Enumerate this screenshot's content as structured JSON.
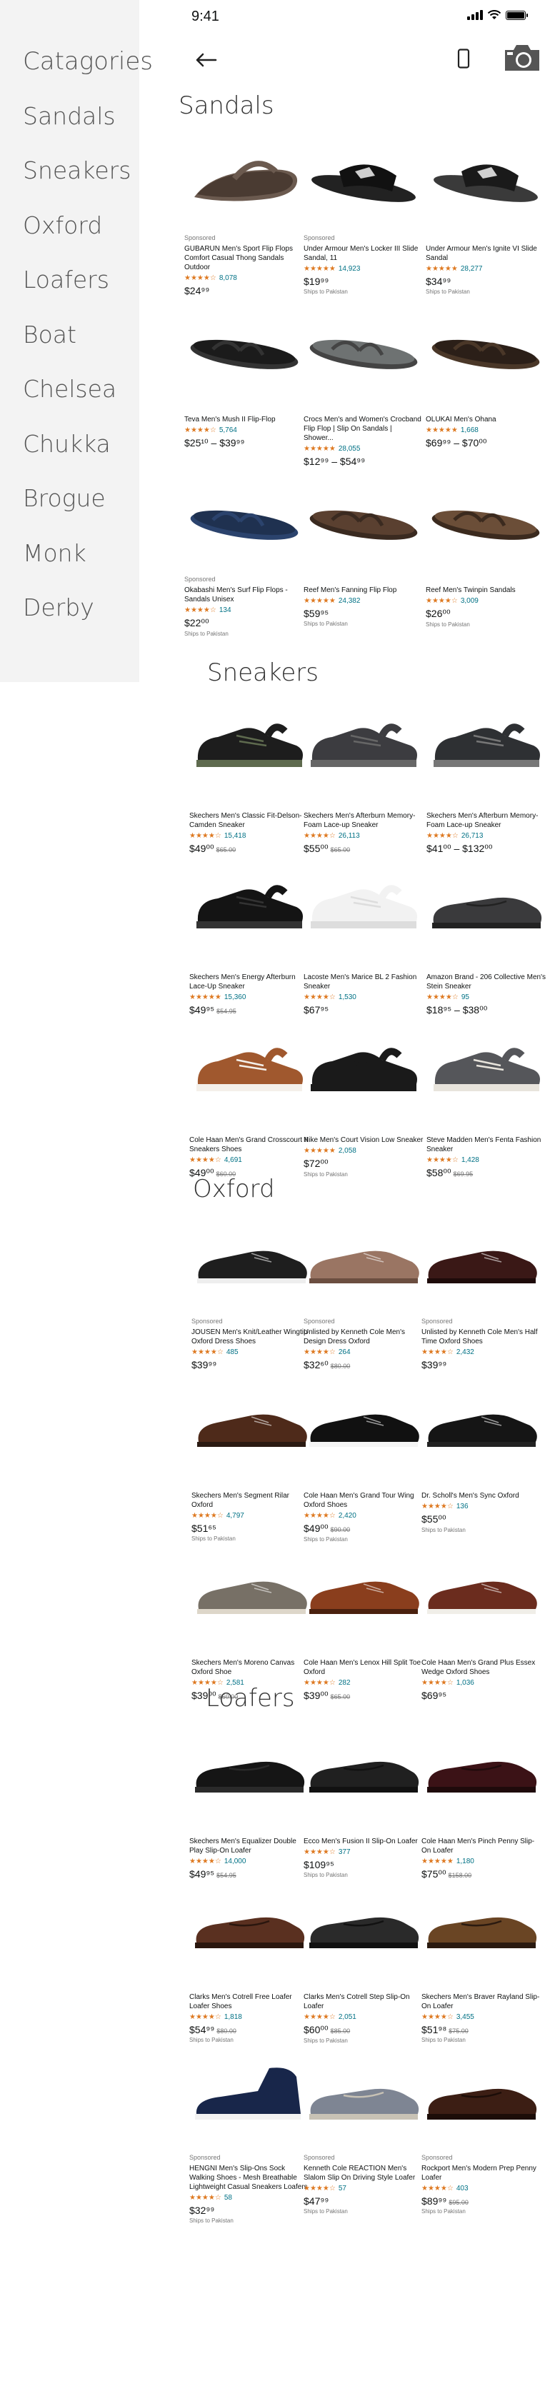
{
  "status": {
    "time": "9:41"
  },
  "sidebar": {
    "items": [
      {
        "label": "Catagories"
      },
      {
        "label": "Sandals"
      },
      {
        "label": "Sneakers"
      },
      {
        "label": "Oxford"
      },
      {
        "label": "Loafers"
      },
      {
        "label": "Boat"
      },
      {
        "label": "Chelsea"
      },
      {
        "label": "Chukka"
      },
      {
        "label": "Brogue"
      },
      {
        "label": "Monk"
      },
      {
        "label": "Derby"
      }
    ]
  },
  "sections": [
    {
      "title": "Sandals",
      "products": [
        {
          "sponsored": "Sponsored",
          "title": "GUBARUN Men's Sport Flip Flops Comfort Casual Thong Sandals Outdoor",
          "stars": "★★★★☆",
          "count": "8,078",
          "price": "$24⁹⁹",
          "strike": "",
          "ships": "",
          "shoe": "sandal-brown"
        },
        {
          "sponsored": "Sponsored",
          "title": "Under Armour Men's Locker III Slide Sandal, 11",
          "stars": "★★★★★",
          "count": "14,923",
          "price": "$19⁹⁹",
          "strike": "",
          "ships": "Ships to Pakistan",
          "shoe": "slide-black"
        },
        {
          "sponsored": "",
          "title": "Under Armour Men's Ignite VI Slide Sandal",
          "stars": "★★★★★",
          "count": "28,277",
          "price": "$34⁹⁹",
          "strike": "",
          "ships": "Ships to Pakistan",
          "shoe": "slide-black2"
        },
        {
          "sponsored": "",
          "title": "Teva Men's Mush II Flip-Flop",
          "stars": "★★★★☆",
          "count": "5,764",
          "price": "$25¹⁰ – $39⁹⁹",
          "strike": "",
          "ships": "",
          "shoe": "flip-black"
        },
        {
          "sponsored": "",
          "title": "Crocs Men's and Women's Crocband Flip Flop | Slip On Sandals | Shower...",
          "stars": "★★★★★",
          "count": "28,055",
          "price": "$12⁹⁹ – $54⁹⁹",
          "strike": "",
          "ships": "",
          "shoe": "flip-gray"
        },
        {
          "sponsored": "",
          "title": "OLUKAI Men's Ohana",
          "stars": "★★★★★",
          "count": "1,668",
          "price": "$69⁹⁹ – $70⁰⁰",
          "strike": "",
          "ships": "",
          "shoe": "flip-darkbrown"
        },
        {
          "sponsored": "Sponsored",
          "title": "Okabashi Men's Surf Flip Flops - Sandals Unisex",
          "stars": "★★★★☆",
          "count": "134",
          "price": "$22⁰⁰",
          "strike": "",
          "ships": "Ships to Pakistan",
          "shoe": "flip-navy"
        },
        {
          "sponsored": "",
          "title": "Reef Men's Fanning Flip Flop",
          "stars": "★★★★★",
          "count": "24,382",
          "price": "$59⁹⁵",
          "strike": "",
          "ships": "Ships to Pakistan",
          "shoe": "flip-brown"
        },
        {
          "sponsored": "",
          "title": "Reef Men's Twinpin Sandals",
          "stars": "★★★★☆",
          "count": "3,009",
          "price": "$26⁰⁰",
          "strike": "",
          "ships": "Ships to Pakistan",
          "shoe": "flip-brown2"
        }
      ]
    },
    {
      "title": "Sneakers",
      "products": [
        {
          "sponsored": "",
          "title": "Skechers Men's Classic Fit-Delson-Camden Sneaker",
          "stars": "★★★★☆",
          "count": "15,418",
          "price": "$49⁰⁰",
          "strike": "$65.00",
          "ships": "",
          "shoe": "sneaker-black-olive"
        },
        {
          "sponsored": "",
          "title": "Skechers Men's Afterburn Memory-Foam Lace-up Sneaker",
          "stars": "★★★★☆",
          "count": "26,113",
          "price": "$55⁰⁰",
          "strike": "$65.00",
          "ships": "",
          "shoe": "sneaker-gray"
        },
        {
          "sponsored": "",
          "title": "Skechers Men's Afterburn Memory-Foam Lace-up Sneaker",
          "stars": "★★★★☆",
          "count": "26,713",
          "price": "$41⁰⁰ – $132⁰⁰",
          "strike": "",
          "ships": "",
          "shoe": "sneaker-charcoal"
        },
        {
          "sponsored": "",
          "title": "Skechers Men's Energy Afterburn Lace-Up Sneaker",
          "stars": "★★★★★",
          "count": "15,360",
          "price": "$49⁹⁵",
          "strike": "$54.95",
          "ships": "",
          "shoe": "sneaker-chunky-black"
        },
        {
          "sponsored": "",
          "title": "Lacoste Men's Marice BL 2 Fashion Sneaker",
          "stars": "★★★★☆",
          "count": "1,530",
          "price": "$67⁹⁵",
          "strike": "",
          "ships": "",
          "shoe": "sneaker-white"
        },
        {
          "sponsored": "",
          "title": "Amazon Brand - 206 Collective Men's Stein Sneaker",
          "stars": "★★★★☆",
          "count": "95",
          "price": "$18⁹⁵ – $38⁰⁰",
          "strike": "",
          "ships": "",
          "shoe": "slipon-charcoal"
        },
        {
          "sponsored": "",
          "title": "Cole Haan Men's Grand Crosscourt II Sneakers Shoes",
          "stars": "★★★★☆",
          "count": "4,691",
          "price": "$49⁰⁰",
          "strike": "$60.00",
          "ships": "",
          "shoe": "sneaker-tan"
        },
        {
          "sponsored": "",
          "title": "Nike Men's Court Vision Low Sneaker",
          "stars": "★★★★★",
          "count": "2,058",
          "price": "$72⁰⁰",
          "strike": "",
          "ships": "Ships to Pakistan",
          "shoe": "sneaker-allblack"
        },
        {
          "sponsored": "",
          "title": "Steve Madden Men's Fenta Fashion Sneaker",
          "stars": "★★★★☆",
          "count": "1,428",
          "price": "$58⁰⁰",
          "strike": "$69.95",
          "ships": "",
          "shoe": "sneaker-gray-gum"
        }
      ]
    },
    {
      "title": "Oxford",
      "products": [
        {
          "sponsored": "Sponsored",
          "title": "JOUSEN Men's Knit/Leather Wingtip Oxford Dress Shoes",
          "stars": "★★★★☆",
          "count": "485",
          "price": "$39⁹⁹",
          "strike": "",
          "ships": "",
          "shoe": "oxford-knit-black"
        },
        {
          "sponsored": "Sponsored",
          "title": "Unlisted by Kenneth Cole Men's Design Dress Oxford",
          "stars": "★★★★☆",
          "count": "264",
          "price": "$32⁶⁰",
          "strike": "$80.00",
          "ships": "",
          "shoe": "oxford-taupe"
        },
        {
          "sponsored": "Sponsored",
          "title": "Unlisted by Kenneth Cole Men's Half Time Oxford Shoes",
          "stars": "★★★★☆",
          "count": "2,432",
          "price": "$39⁹⁹",
          "strike": "",
          "ships": "",
          "shoe": "oxford-burgundy"
        },
        {
          "sponsored": "",
          "title": "Skechers Men's Segment Rilar Oxford",
          "stars": "★★★★☆",
          "count": "4,797",
          "price": "$51⁶⁵",
          "strike": "",
          "ships": "Ships to Pakistan",
          "shoe": "oxford-brown-casual"
        },
        {
          "sponsored": "",
          "title": "Cole Haan Men's Grand Tour Wing Oxford Shoes",
          "stars": "★★★★☆",
          "count": "2,420",
          "price": "$49⁰⁰",
          "strike": "$90.00",
          "ships": "Ships to Pakistan",
          "shoe": "oxford-black-white"
        },
        {
          "sponsored": "",
          "title": "Dr. Scholl's Men's Sync Oxford",
          "stars": "★★★★☆",
          "count": "136",
          "price": "$55⁰⁰",
          "strike": "",
          "ships": "Ships to Pakistan",
          "shoe": "oxford-black"
        },
        {
          "sponsored": "",
          "title": "Skechers Men's Moreno Canvas Oxford Shoe",
          "stars": "★★★★☆",
          "count": "2,581",
          "price": "$39⁰⁰",
          "strike": "$60.00",
          "ships": "",
          "shoe": "oxford-gray-canvas"
        },
        {
          "sponsored": "",
          "title": "Cole Haan Men's Lenox Hill Split Toe Oxford",
          "stars": "★★★★☆",
          "count": "282",
          "price": "$39⁰⁰",
          "strike": "$65.00",
          "ships": "",
          "shoe": "oxford-cognac"
        },
        {
          "sponsored": "",
          "title": "Cole Haan Men's Grand Plus Essex Wedge Oxford Shoes",
          "stars": "★★★★☆",
          "count": "1,036",
          "price": "$69⁹⁵",
          "strike": "",
          "ships": "",
          "shoe": "oxford-chili"
        }
      ]
    },
    {
      "title": "Loafers",
      "products": [
        {
          "sponsored": "",
          "title": "Skechers Men's Equalizer Double Play Slip-On Loafer",
          "stars": "★★★★☆",
          "count": "14,000",
          "price": "$49⁹⁵",
          "strike": "$54.95",
          "ships": "",
          "shoe": "loafer-black-sporty"
        },
        {
          "sponsored": "",
          "title": "Ecco Men's Fusion II Slip-On Loafer",
          "stars": "★★★★☆",
          "count": "377",
          "price": "$109⁹⁵",
          "strike": "",
          "ships": "Ships to Pakistan",
          "shoe": "loafer-black"
        },
        {
          "sponsored": "",
          "title": "Cole Haan Men's Pinch Penny Slip-On Loafer",
          "stars": "★★★★★",
          "count": "1,180",
          "price": "$75⁰⁰",
          "strike": "$158.00",
          "ships": "",
          "shoe": "loafer-burgundy"
        },
        {
          "sponsored": "",
          "title": "Clarks Men's Cotrell Free Loafer Loafer Shoes",
          "stars": "★★★★☆",
          "count": "1,818",
          "price": "$54⁹⁹",
          "strike": "$80.00",
          "ships": "Ships to Pakistan",
          "shoe": "loafer-brown"
        },
        {
          "sponsored": "",
          "title": "Clarks Men's Cotrell Step Slip-On Loafer",
          "stars": "★★★★☆",
          "count": "2,051",
          "price": "$60⁰⁰",
          "strike": "$85.00",
          "ships": "Ships to Pakistan",
          "shoe": "loafer-black2"
        },
        {
          "sponsored": "",
          "title": "Skechers Men's Braver Rayland Slip-On Loafer",
          "stars": "★★★★☆",
          "count": "3,455",
          "price": "$51⁹⁸",
          "strike": "$75.00",
          "ships": "Ships to Pakistan",
          "shoe": "loafer-tan-casual"
        },
        {
          "sponsored": "Sponsored",
          "title": "HENGNI Men's Slip-Ons Sock Walking Shoes - Mesh Breathable Lightweight Casual Sneakers Loafers",
          "stars": "★★★★☆",
          "count": "58",
          "price": "$32⁹⁹",
          "strike": "",
          "ships": "Ships to Pakistan",
          "shoe": "sock-navy"
        },
        {
          "sponsored": "Sponsored",
          "title": "Kenneth Cole REACTION Men's Slalom Slip On Driving Style Loafer",
          "stars": "★★★★☆",
          "count": "57",
          "price": "$47⁹⁹",
          "strike": "",
          "ships": "Ships to Pakistan",
          "shoe": "moc-gray"
        },
        {
          "sponsored": "Sponsored",
          "title": "Rockport Men's Modern Prep Penny Loafer",
          "stars": "★★★★☆",
          "count": "403",
          "price": "$89⁹⁹",
          "strike": "$95.00",
          "ships": "Ships to Pakistan",
          "shoe": "loafer-dark-brown"
        }
      ]
    }
  ]
}
